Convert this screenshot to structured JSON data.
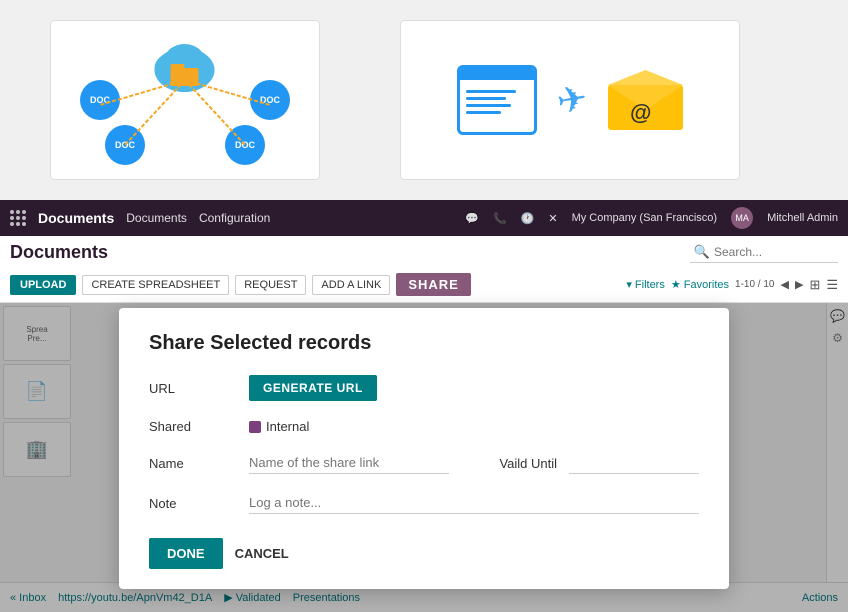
{
  "top_images": {
    "left_alt": "Cloud document sharing illustration",
    "right_alt": "Document email sharing illustration"
  },
  "appbar": {
    "grid_label": "apps-grid",
    "app_name": "Documents",
    "menu_items": [
      "Documents",
      "Configuration"
    ],
    "right_icons": [
      "chat-icon",
      "phone-icon",
      "timer-icon",
      "close-icon"
    ],
    "company": "My Company (San Francisco)",
    "user": "Mitchell Admin"
  },
  "doc_title_bar": {
    "title": "Documents",
    "search_placeholder": "Search..."
  },
  "toolbar": {
    "upload_label": "UPLOAD",
    "create_spreadsheet_label": "CREATE SPREADSHEET",
    "request_label": "REQUEST",
    "add_link_label": "ADD A LINK",
    "share_label": "SHARE",
    "filters_label": "▾ Filters",
    "favorites_label": "★ Favorites",
    "pagination": "1-10 / 10",
    "view_grid_label": "⊞",
    "view_list_label": "≡"
  },
  "modal": {
    "title": "Share Selected records",
    "url_label": "URL",
    "generate_url_button": "GENERATE URL",
    "shared_label": "Shared",
    "shared_value": "Internal",
    "name_label": "Name",
    "name_placeholder": "Name of the share link",
    "valid_until_label": "Vaild Until",
    "valid_until_placeholder": "",
    "note_label": "Note",
    "note_placeholder": "Log a note...",
    "done_button": "DONE",
    "cancel_button": "CANCEL"
  },
  "bottom_bar": {
    "inbox_label": "« Inbox",
    "url_text": "https://youtu.be/ApnVm42_D1A",
    "validated_label": "▶ Validated",
    "presentations_label": "Presentations",
    "actions_label": "Actions"
  }
}
